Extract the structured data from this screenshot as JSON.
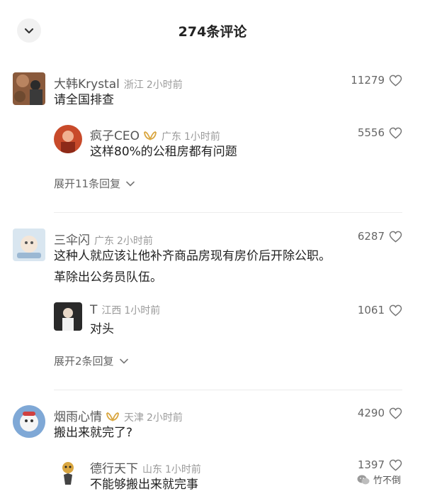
{
  "header": {
    "title": "274条评论",
    "collapse_icon": "chevron-down-icon"
  },
  "colors": {
    "badge_gold": "#d9a640",
    "meta_gray": "#9a9a9a",
    "username_gray": "#555555"
  },
  "comments": [
    {
      "username": "大韩Krystal",
      "region": "浙江",
      "time": "2小时前",
      "text": "请全国排查",
      "likes": "11279",
      "replies": [
        {
          "username": "疯子CEO",
          "badge": "vip-badge-icon",
          "region": "广东",
          "time": "1小时前",
          "text": "这样80%的公租房都有问题",
          "likes": "5556"
        }
      ],
      "expand": "展开11条回复"
    },
    {
      "username": "三伞闪",
      "region": "广东",
      "time": "2小时前",
      "text_line1": "这种人就应该让他补齐商品房现有房价后开除公职。",
      "text_line2": "革除出公务员队伍。",
      "likes": "6287",
      "replies": [
        {
          "username": "T",
          "region": "江西",
          "time": "1小时前",
          "text": "对头",
          "likes": "1061"
        }
      ],
      "expand": "展开2条回复"
    },
    {
      "username": "烟雨心情",
      "badge": "vip-badge-icon",
      "region": "天津",
      "time": "2小时前",
      "text": "搬出来就完了?",
      "likes": "4290",
      "replies": [
        {
          "username": "德行天下",
          "region": "山东",
          "time": "1小时前",
          "text": "不能够搬出来就完事",
          "likes": "1397"
        }
      ]
    }
  ],
  "watermark": {
    "text": "竹不倒",
    "icon": "wechat-icon"
  }
}
